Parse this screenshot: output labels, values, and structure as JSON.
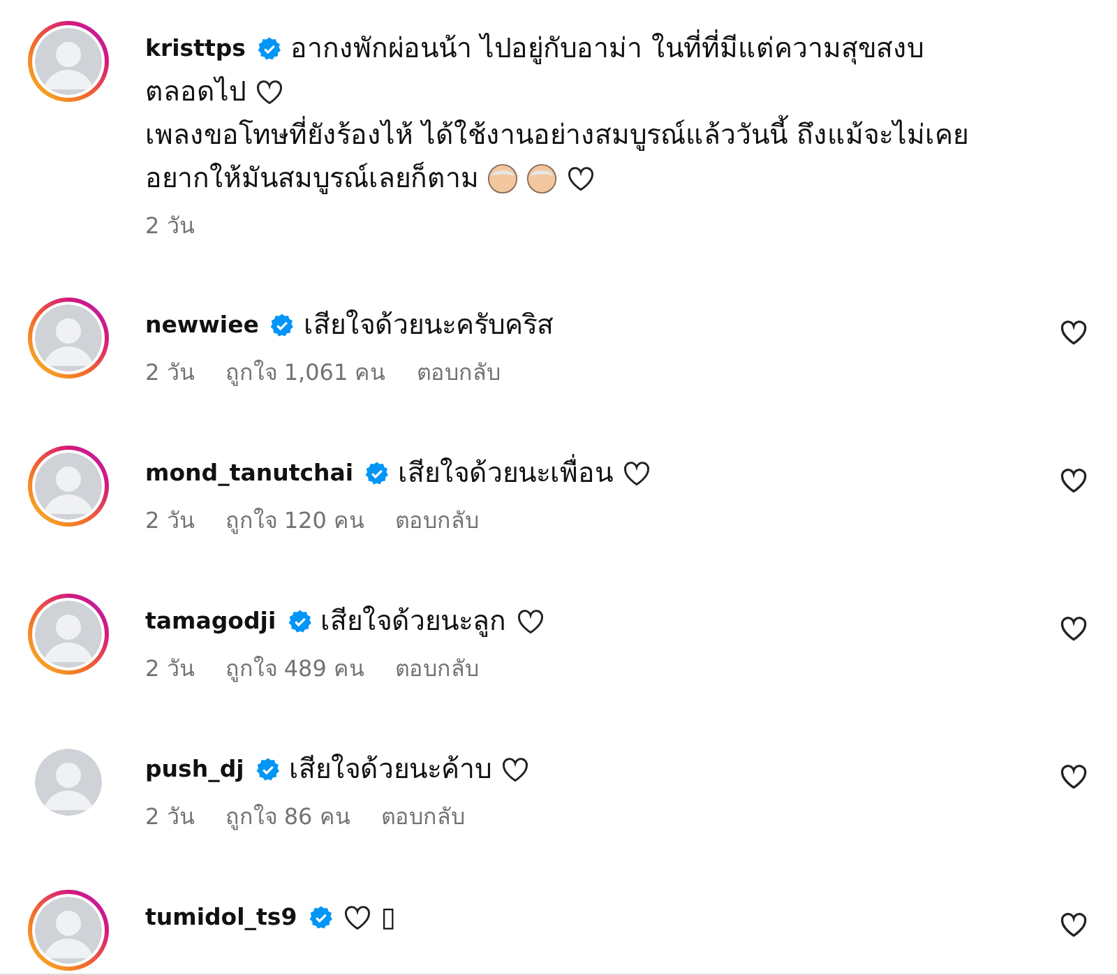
{
  "caption": {
    "username": "kristtps",
    "story_ring": true,
    "lines": [
      {
        "parts": [
          {
            "kind": "text",
            "text": "อากงพักผ่อนน้า ไปอยู่กับอาม่า ในที่ที่มีแต่ความสุขสงบ"
          }
        ]
      },
      {
        "parts": [
          {
            "kind": "text",
            "text": "ตลอดไป"
          },
          {
            "kind": "heart"
          }
        ]
      },
      {
        "parts": [
          {
            "kind": "text",
            "text": "เพลงขอโทษที่ยังร้องไห้ ได้ใช้งานอย่างสมบูรณ์แล้ววันนี้ ถึงแม้จะไม่เคย"
          }
        ]
      },
      {
        "parts": [
          {
            "kind": "text",
            "text": "อยากให้มันสมบูรณ์เลยก็ตาม"
          },
          {
            "kind": "emoji"
          },
          {
            "kind": "emoji"
          },
          {
            "kind": "heart"
          }
        ]
      }
    ],
    "time": "2 วัน"
  },
  "comments": [
    {
      "username": "newwiee",
      "story_ring": true,
      "parts": [
        {
          "kind": "text",
          "text": "เสียใจด้วยนะครับคริส"
        }
      ],
      "time": "2 วัน",
      "likes": "ถูกใจ 1,061 คน",
      "reply": "ตอบกลับ"
    },
    {
      "username": "mond_tanutchai",
      "story_ring": true,
      "parts": [
        {
          "kind": "text",
          "text": "เสียใจด้วยนะเพื่อน"
        },
        {
          "kind": "heart"
        }
      ],
      "time": "2 วัน",
      "likes": "ถูกใจ 120 คน",
      "reply": "ตอบกลับ"
    },
    {
      "username": "tamagodji",
      "story_ring": true,
      "parts": [
        {
          "kind": "text",
          "text": "เสียใจด้วยนะลูก"
        },
        {
          "kind": "heart"
        }
      ],
      "time": "2 วัน",
      "likes": "ถูกใจ 489 คน",
      "reply": "ตอบกลับ"
    },
    {
      "username": "push_dj",
      "story_ring": false,
      "parts": [
        {
          "kind": "text",
          "text": "เสียใจด้วยนะค้าบ"
        },
        {
          "kind": "heart"
        }
      ],
      "time": "2 วัน",
      "likes": "ถูกใจ 86 คน",
      "reply": "ตอบกลับ"
    },
    {
      "username": "tumidol_ts9",
      "story_ring": true,
      "parts": [
        {
          "kind": "heart"
        },
        {
          "kind": "text",
          "text": "▯"
        }
      ]
    }
  ]
}
